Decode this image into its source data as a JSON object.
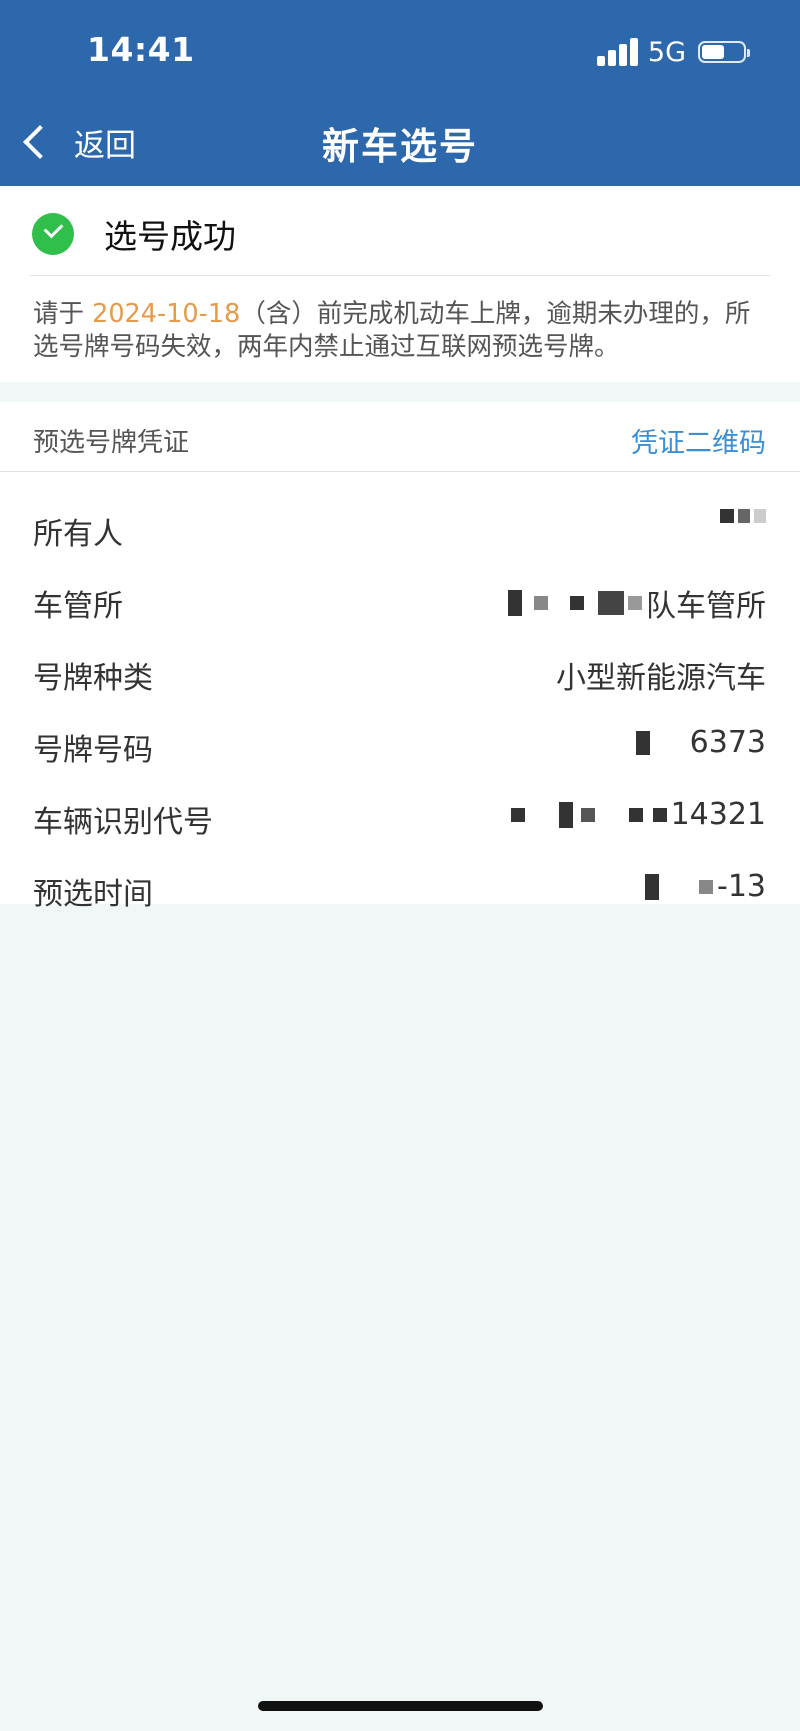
{
  "status_bar": {
    "time": "14:41",
    "network": "5G"
  },
  "nav": {
    "back_label": "返回",
    "title": "新车选号"
  },
  "success": {
    "text": "选号成功",
    "notice_prefix": "请于 ",
    "notice_date": "2024-10-18",
    "notice_suffix": "（含）前完成机动车上牌，逾期未办理的，所选号牌号码失效，两年内禁止通过互联网预选号牌。"
  },
  "voucher": {
    "title": "预选号牌凭证",
    "qr_link": "凭证二维码",
    "rows": [
      {
        "label": "所有人",
        "value": ""
      },
      {
        "label": "车管所",
        "value": "队车管所"
      },
      {
        "label": "号牌种类",
        "value": "小型新能源汽车"
      },
      {
        "label": "号牌号码",
        "value": "6373"
      },
      {
        "label": "车辆识别代号",
        "value": "14321"
      },
      {
        "label": "预选时间",
        "value": "-13"
      }
    ]
  },
  "colors": {
    "header_bg": "#2c68ab",
    "success_green": "#2fbf4a",
    "date_orange": "#e59a4c",
    "link_blue": "#3a8fd6",
    "page_bg": "#f1f6f7"
  }
}
